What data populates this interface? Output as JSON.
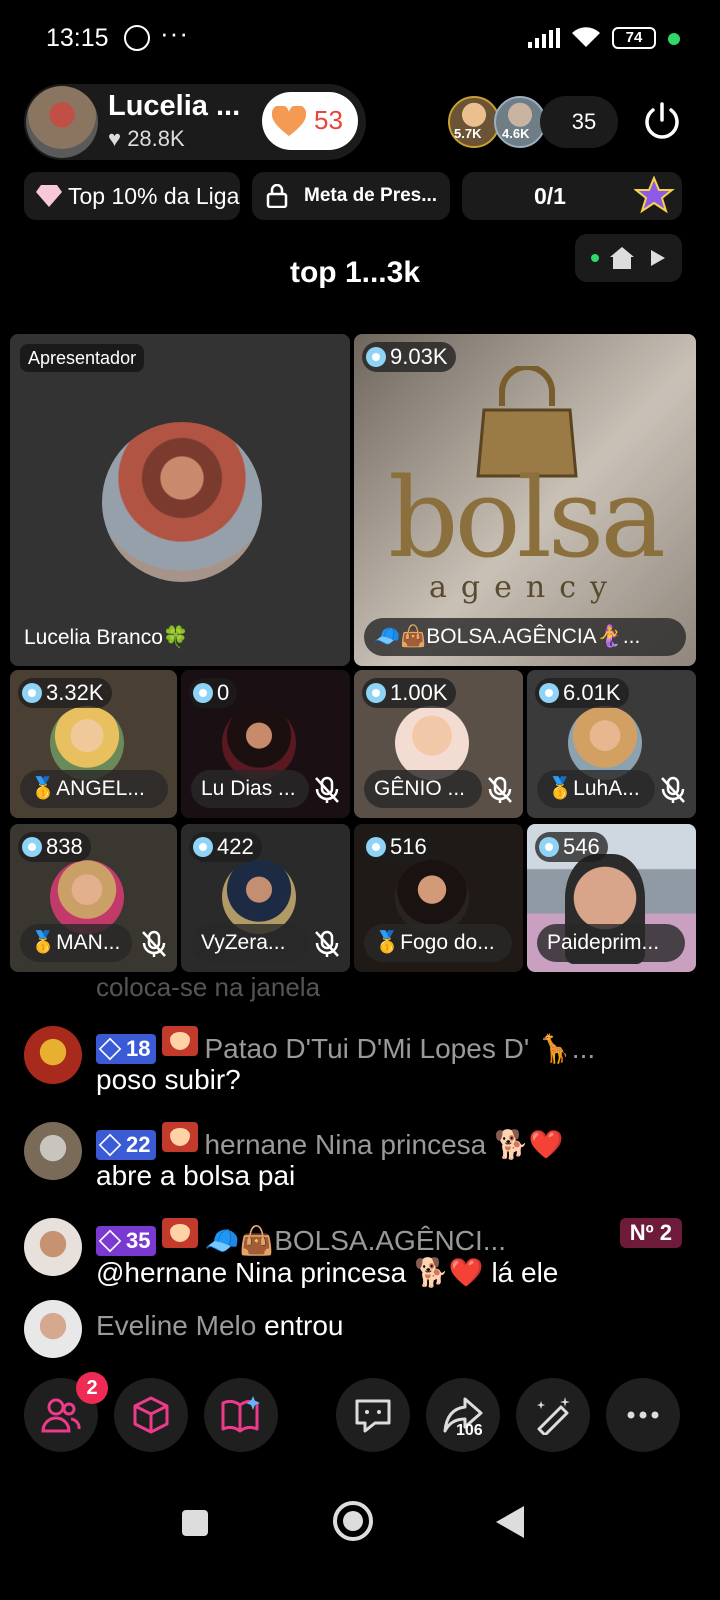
{
  "status": {
    "time": "13:15",
    "battery": "74"
  },
  "host": {
    "name": "Lucelia ...",
    "likes": "28.8K",
    "fan_count": "53"
  },
  "viewers": {
    "top1": "5.7K",
    "top2": "4.6K",
    "count": "35"
  },
  "pills": {
    "rank": "Top 10% da Liga",
    "goal": "Meta de Pres...",
    "progress": "0/1"
  },
  "room_title": "top 1...3k",
  "host_tile": {
    "role": "Apresentador",
    "name": "Lucelia Branco🍀"
  },
  "guests": [
    {
      "score": "9.03K",
      "name": "🧢👜BOLSA.AGÊNCIA🧜‍♀️...",
      "logo_word": "bolsa",
      "logo_sub": "agency"
    },
    {
      "score": "3.32K",
      "name": "🥇ANGEL..."
    },
    {
      "score": "0",
      "name": "Lu Dias ..."
    },
    {
      "score": "1.00K",
      "name": "GÊNIO ..."
    },
    {
      "score": "6.01K",
      "name": "🥇LuhA..."
    },
    {
      "score": "838",
      "name": "🥇MAN..."
    },
    {
      "score": "422",
      "name": "VyZera..."
    },
    {
      "score": "516",
      "name": "🥇Fogo do..."
    },
    {
      "score": "546",
      "name": "Paideprim..."
    }
  ],
  "chat": {
    "ghost": "coloca-se na janela",
    "messages": [
      {
        "level": "18",
        "user": "Patao D'Tui D'Mi Lopes D' 🦒...",
        "text": "poso subir?"
      },
      {
        "level": "22",
        "user": "hernane  Nina princesa  🐕❤️",
        "text": "abre a bolsa pai"
      },
      {
        "level": "35",
        "user": "🧢👜BOLSA.AGÊNCI...",
        "rank": "Nº 2",
        "text": "@hernane  Nina princesa  🐕❤️ lá ele"
      }
    ],
    "join": {
      "user": "Eveline Melo",
      "action": "entrou"
    }
  },
  "toolbar": {
    "notif": "2",
    "share_count": "106"
  },
  "colors": {
    "accent": "#ee2a55",
    "level_blue": "#3b5bd6",
    "level_purple": "#7a3ad1"
  }
}
